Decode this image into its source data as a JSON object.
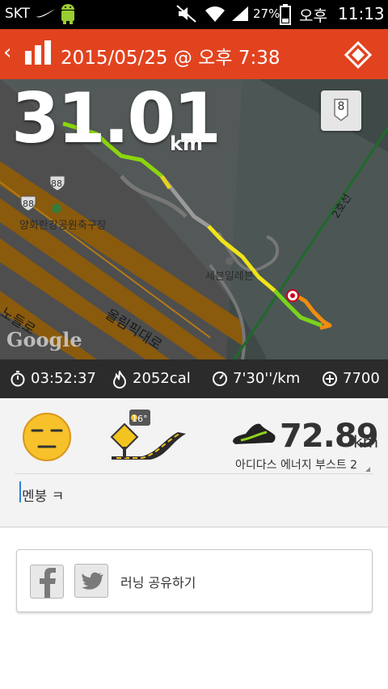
{
  "status_bar": {
    "carrier": "SKT",
    "battery": "27%",
    "ampm": "오후",
    "time": "11:13"
  },
  "header": {
    "title": "2015/05/25 @ 오후 7:38",
    "accent_color": "#e2431f"
  },
  "map": {
    "distance": "31.01",
    "distance_unit": "km",
    "shoe_badge": "8",
    "labels": {
      "route_88": "88",
      "park": "양화한강공원축구장",
      "seven_eleven": "세븐일레븐",
      "olympic_road": "올림픽대로",
      "nodeul_road": "노들로",
      "subway_line": "2호선",
      "google": "Google"
    }
  },
  "stats": {
    "duration": "03:52:37",
    "calories": "2052cal",
    "pace": "7'30''/km",
    "fuel": "7700"
  },
  "details": {
    "weather_temp": "16°",
    "shoe_distance": "72.89",
    "shoe_distance_unit": "km",
    "shoe_name": "아디다스 에너지 부스트 2",
    "note": "멘붕 ㅋ"
  },
  "share": {
    "label": "러닝 공유하기"
  }
}
